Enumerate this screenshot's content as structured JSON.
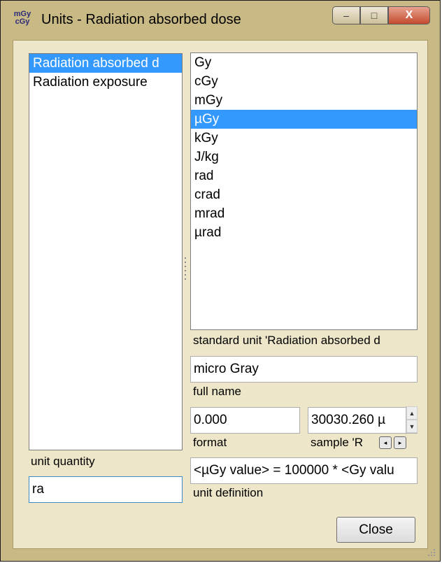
{
  "window": {
    "title": "Units - Radiation absorbed dose",
    "app_icon_text": [
      "mGy",
      "cGy"
    ],
    "caption_buttons": {
      "minimize": "–",
      "maximize": "□",
      "close": "X"
    }
  },
  "quantities": {
    "items": [
      "Radiation absorbed d",
      "Radiation exposure"
    ],
    "selected_index": 0,
    "label": "unit quantity",
    "search_value": "ra"
  },
  "units": {
    "items": [
      "Gy",
      "cGy",
      "mGy",
      "µGy",
      "kGy",
      "J/kg",
      "rad",
      "crad",
      "mrad",
      "µrad"
    ],
    "selected_index": 3,
    "standard_unit_label": "standard unit  'Radiation absorbed d"
  },
  "full_name": {
    "value": "micro Gray",
    "label": "full name"
  },
  "format": {
    "value": "0.000",
    "label": "format"
  },
  "sample": {
    "value": "30030.260 µ",
    "label": "sample 'R",
    "prev": "◂",
    "next": "▸"
  },
  "definition": {
    "value": "<µGy value> = 100000 * <Gy valu",
    "label": "unit definition"
  },
  "close_label": "Close"
}
